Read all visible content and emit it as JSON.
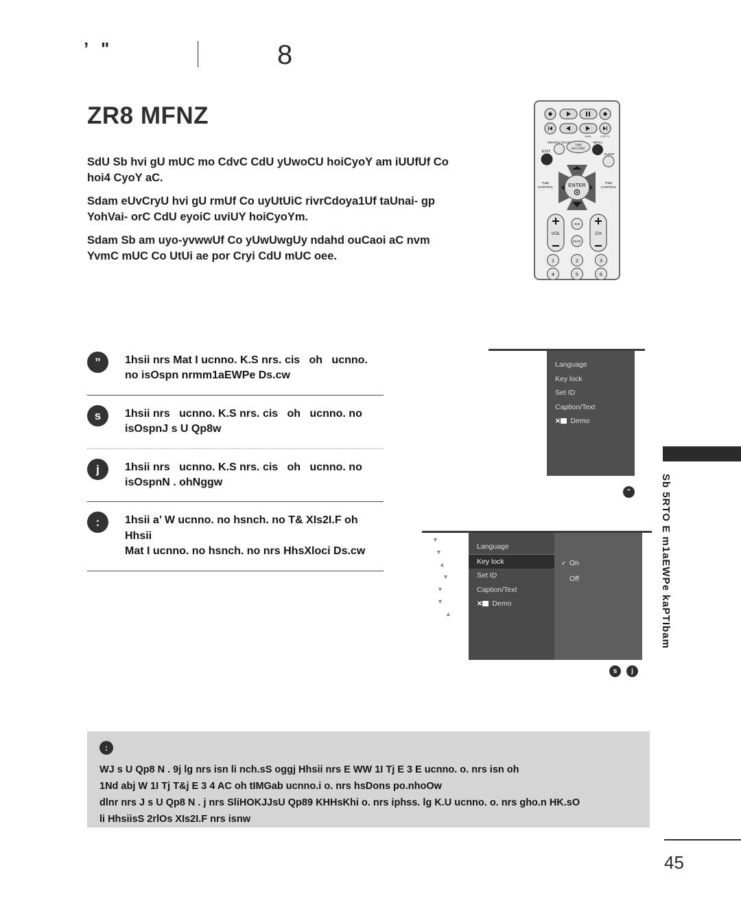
{
  "header": {
    "marks": "’ \"",
    "number": "8"
  },
  "title": "ZR8 MFNZ",
  "intro": [
    "SdU Sb hvi gU mUC mo CdvC CdU yUwoCU hoiCyoY am iUUfUf Co hoi4 CyoY aC.",
    "Sdam eUvCryU hvi gU rmUf Co uyUtUiC rivrCdoya1Uf taUnai- gp YohVai- orC CdU eyoiC uviUY hoiCyoYm.",
    "Sdam Sb am uyo-yvwwUf Co yUwUwgUy ndahd ouCaoi aC nvm YvmC mUC Co UtUi ae por Cryi CdU mUC oee."
  ],
  "steps": [
    {
      "bullet": "”",
      "line1_a": "1hsii nrs ",
      "line1_em": "Mat I",
      "line1_b": " ucnno. K.S nrs. cis",
      "line1_c": "oh",
      "line1_d": "ucnno.",
      "line2_a": "no isOspn nrm",
      "line2_em": "m1aEWPe",
      "line2_b": " Ds.cw"
    },
    {
      "bullet": "s",
      "line1_a": "1hsii nrs",
      "line1_b": "ucnno. K.S nrs. cis",
      "line1_c": "oh",
      "line1_d": "ucnno. no",
      "line2_a": "isOspn",
      "line2_em": "J s U Qp8",
      "line2_b": "w"
    },
    {
      "bullet": "j",
      "line1_a": "1hsii nrs",
      "line1_b": "ucnno. K.S nrs. cis",
      "line1_c": "oh",
      "line1_d": "ucnno. no",
      "line2_a": "isOspn",
      "line2_em": "N . ohNgg",
      "line2_b": "w"
    },
    {
      "bullet": ":",
      "line1_a": "1hsii ",
      "line1_em": "a’ W",
      "line1_b": " ucnno. no hsnch. no T& XIs2I.F oh Hhsii",
      "line2_em": "Mat I",
      "line2_b": " ucnno. no hsnch. no nrs HhsXloci Ds.cw"
    }
  ],
  "osd": {
    "menu_items": [
      "Language",
      "Key lock",
      "Set ID",
      "Caption/Text"
    ],
    "xd_label": "Demo",
    "xd_logo": "XD",
    "highlighted_item": "Key lock",
    "options": [
      {
        "label": "On",
        "checked": true
      },
      {
        "label": "Off",
        "checked": false
      }
    ],
    "check_glyph": "✓",
    "marker_top": "”",
    "marker_left": "s",
    "marker_right": "j",
    "arrows": [
      "▼",
      "▼",
      "▲",
      "▼",
      "▼",
      "▼",
      "▲"
    ]
  },
  "sidebar": {
    "vertical_text": "Sb 5RTO  E m1aEWPe kaPTIbam"
  },
  "note": {
    "icon": ":",
    "lines": [
      "WJ s U Qp8 N . 9j lg nrs isn li nch.sS oggj Hhsii nrs  E WW 1I Tj E 3    E   ucnno. o. nrs isn oh",
      "1Nd abj W 1I Tj T&j E 3  4 AC oh  tIMGab ucnno.i o. nrs hsDons po.nhoOw",
      "dlnr nrs  J s U Qp8 N . j nrs SliHOKJJsU Qp89 KHHsKhi o. nrs iphss. lg K.U ucnno. o. nrs gho.n HK.sO",
      "li HhsiisS 2rlOs XIs2I.F nrs isnw"
    ]
  },
  "footer": {
    "page_number": "45"
  }
}
